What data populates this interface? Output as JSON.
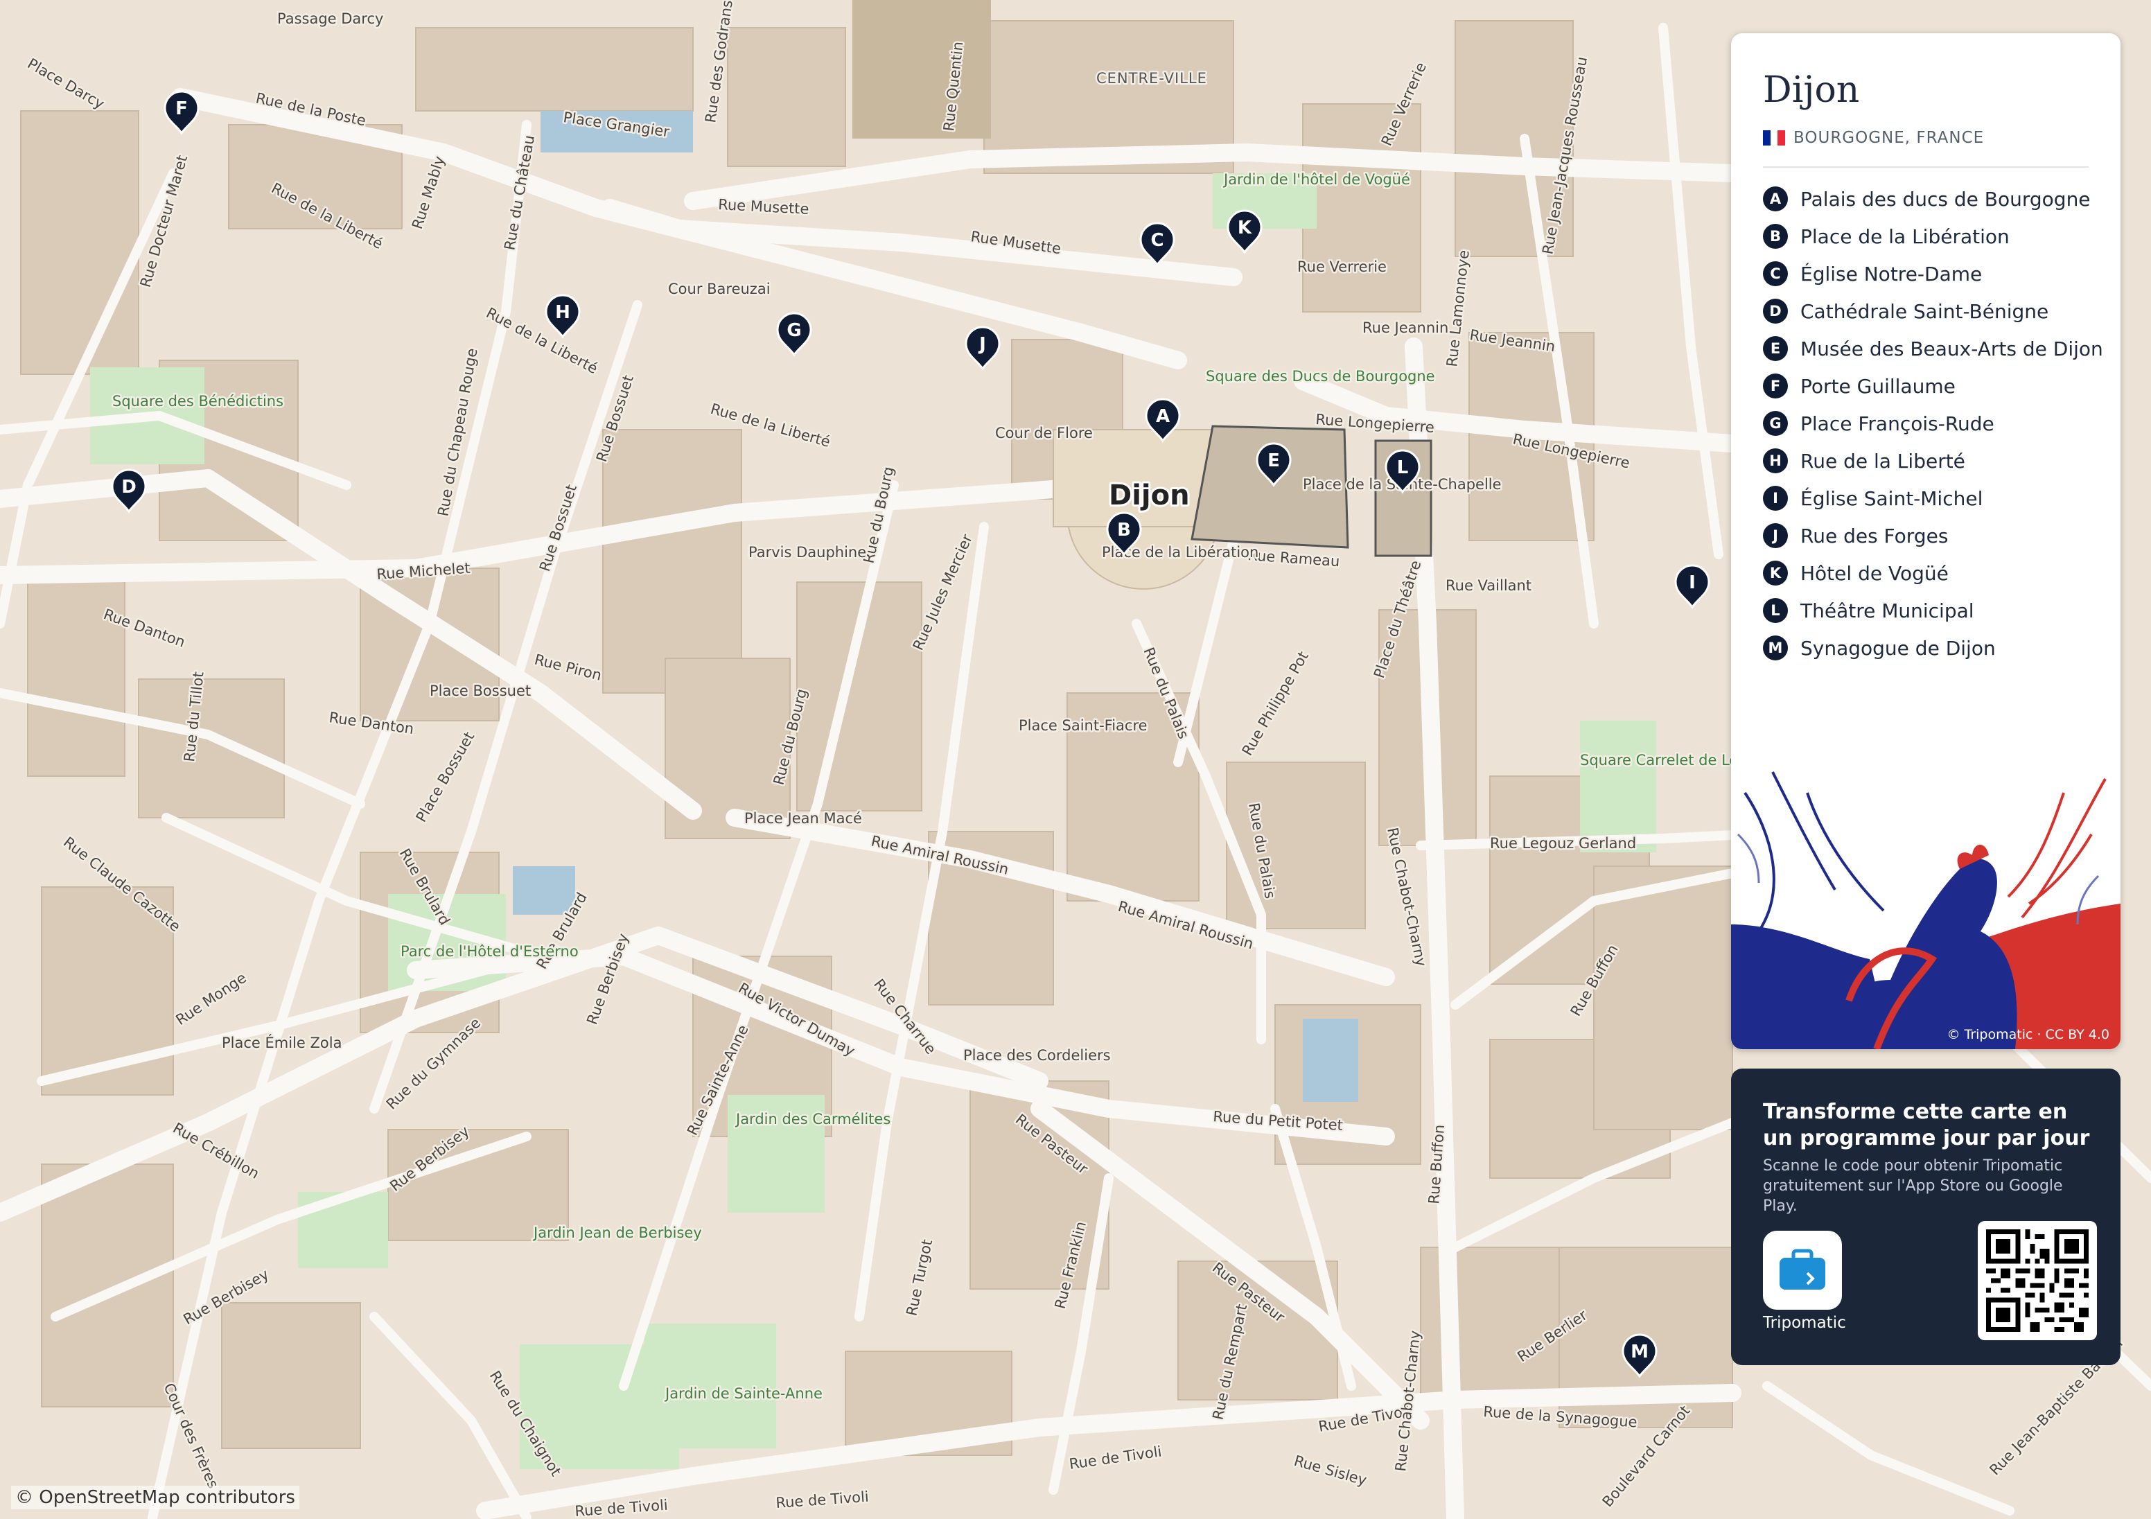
{
  "map": {
    "district": "CENTRE-VILLE",
    "city_label": "Dijon",
    "streets": [
      "Passage Darcy",
      "Place Darcy",
      "Rue de la Poste",
      "Place Grangier",
      "Rue des Godrans",
      "Rue Quentin",
      "Rue Docteur Maret",
      "Rue de la Liberté",
      "Rue Mably",
      "Rue du Château",
      "Rue Musette",
      "Rue Musette",
      "Cour Bareuzai",
      "Rue Verrerie",
      "Rue Verrerie",
      "Rue Jeannin",
      "Rue Jeannin",
      "Rue Lamonnoye",
      "Rue Jean-Jacques Rousseau",
      "Rue de la Liberté",
      "Rue du Chapeau Rouge",
      "Rue Bossuet",
      "Rue de la Liberté",
      "Cour de Flore",
      "Rue Longepierre",
      "Rue Longepierre",
      "Place de la Sainte-Chapelle",
      "Rue du Bourg",
      "Parvis Dauphine",
      "Rue Michelet",
      "Rue Bossuet",
      "Rue Rameau",
      "Place de la Libération",
      "Rue Vaillant",
      "Place du Théâtre",
      "Rue Jules Mercier",
      "Rue Danton",
      "Rue du Tillot",
      "Rue Piron",
      "Place Bossuet",
      "Rue Danton",
      "Rue du Palais",
      "Rue Philippe Pot",
      "Place Saint-Fiacre",
      "Rue du Bourg",
      "Rue Claude Cazotte",
      "Place Bossuet",
      "Place Jean Macé",
      "Rue Amiral Roussin",
      "Rue du Palais",
      "Rue Chabot-Charny",
      "Rue Legouz Gerland",
      "Rue Brulard",
      "Rue Brulard",
      "Rue Amiral Roussin",
      "Rue Monge",
      "Place Émile Zola",
      "Rue Berbisey",
      "Rue Victor Dumay",
      "Rue Charrue",
      "Rue du Gymnase",
      "Rue Buffon",
      "Place des Cordeliers",
      "Rue Crébillon",
      "Rue Berbisey",
      "Rue Sainte-Anne",
      "Rue du Petit Potet",
      "Rue Pasteur",
      "Rue Buffon",
      "Rue Berbisey",
      "Rue Turgot",
      "Rue Franklin",
      "Rue Pasteur",
      "Rue du Rempart",
      "Rue Berlier",
      "Rue du Chaignot",
      "Cour des Frères",
      "Rue de Tivoli",
      "Rue de Tivoli",
      "Rue de la Synagogue",
      "Rue Chabot-Charny",
      "Rue de Tivoli",
      "Rue Sisley",
      "Boulevard Carnot",
      "Rue Jean-Baptiste Baudin",
      "Rue de Tivoli"
    ],
    "parks": [
      "Jardin de l'hôtel de Vogüé",
      "Square des Bénédictins",
      "Square des Ducs de Bourgogne",
      "Square Carrelet de Loisy",
      "Parc de l'Hôtel d'Esterno",
      "Jardin des Carmélites",
      "Jardin Jean de Berbisey",
      "Jardin de Sainte-Anne"
    ],
    "pins": [
      "A",
      "B",
      "C",
      "D",
      "E",
      "F",
      "G",
      "H",
      "I",
      "J",
      "K",
      "L",
      "M"
    ],
    "attribution": "© OpenStreetMap contributors"
  },
  "panel": {
    "title": "Dijon",
    "region": "BOURGOGNE, FRANCE",
    "flag_colors": [
      "#002395",
      "#ffffff",
      "#ed2939"
    ],
    "poi": [
      {
        "letter": "A",
        "name": "Palais des ducs de Bourgogne"
      },
      {
        "letter": "B",
        "name": "Place de la Libération"
      },
      {
        "letter": "C",
        "name": "Église Notre-Dame"
      },
      {
        "letter": "D",
        "name": "Cathédrale Saint-Bénigne"
      },
      {
        "letter": "E",
        "name": "Musée des Beaux-Arts de Dijon"
      },
      {
        "letter": "F",
        "name": "Porte Guillaume"
      },
      {
        "letter": "G",
        "name": "Place François-Rude"
      },
      {
        "letter": "H",
        "name": "Rue de la Liberté"
      },
      {
        "letter": "I",
        "name": "Église Saint-Michel"
      },
      {
        "letter": "J",
        "name": "Rue des Forges"
      },
      {
        "letter": "K",
        "name": "Hôtel de Vogüé"
      },
      {
        "letter": "L",
        "name": "Théâtre Municipal"
      },
      {
        "letter": "M",
        "name": "Synagogue de Dijon"
      }
    ],
    "art_credit": "© Tripomatic · CC BY 4.0"
  },
  "promo": {
    "title": "Transforme cette carte en un programme jour par jour",
    "text": "Scanne le code pour obtenir Tripomatic gratuitement sur l'App Store ou Google Play.",
    "app_name": "Tripomatic"
  },
  "colors": {
    "background": "#ece3d6",
    "buildings": "#d9cbb8",
    "roads": "#faf8f4",
    "parks": "#cfe8c6",
    "water": "#aac8da",
    "pin": "#0e1b33",
    "panel_dark": "#1b2638"
  }
}
